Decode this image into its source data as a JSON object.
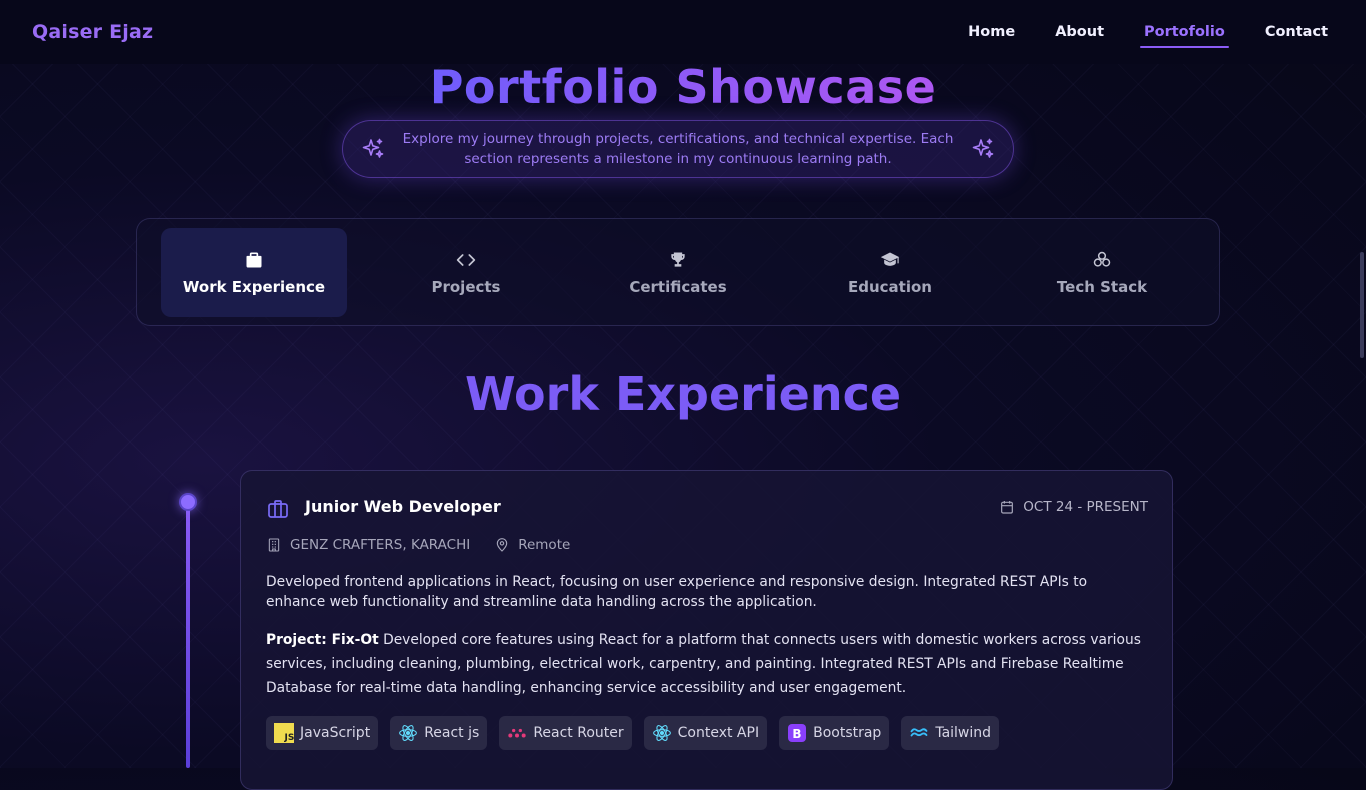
{
  "brand": "Qaiser Ejaz",
  "nav": [
    {
      "label": "Home",
      "active": false
    },
    {
      "label": "About",
      "active": false
    },
    {
      "label": "Portofolio",
      "active": true
    },
    {
      "label": "Contact",
      "active": false
    }
  ],
  "hero": {
    "title": "Portfolio Showcase",
    "subtitle": "Explore my journey through projects, certifications, and technical expertise. Each section represents a milestone in my continuous learning path."
  },
  "tabs": [
    {
      "label": "Work Experience",
      "icon": "briefcase-icon",
      "active": true
    },
    {
      "label": "Projects",
      "icon": "code-icon",
      "active": false
    },
    {
      "label": "Certificates",
      "icon": "trophy-icon",
      "active": false
    },
    {
      "label": "Education",
      "icon": "graduation-cap-icon",
      "active": false
    },
    {
      "label": "Tech Stack",
      "icon": "stack-icon",
      "active": false
    }
  ],
  "section": {
    "title": "Work Experience"
  },
  "job": {
    "title": "Junior Web Developer",
    "date": "OCT 24 - PRESENT",
    "company": "GENZ CRAFTERS, KARACHI",
    "location": "Remote",
    "description": "Developed frontend applications in React, focusing on user experience and responsive design. Integrated REST APIs to enhance web functionality and streamline data handling across the application.",
    "project_label": "Project: Fix-Ot",
    "project_text": " Developed core features using React for a platform that connects users with domestic workers across various services, including cleaning, plumbing, electrical work, carpentry, and painting. Integrated REST APIs and Firebase Realtime Database for real-time data handling, enhancing service accessibility and user engagement.",
    "skills": [
      {
        "label": "JavaScript",
        "icon": "javascript-icon"
      },
      {
        "label": "React js",
        "icon": "react-icon"
      },
      {
        "label": "React Router",
        "icon": "react-router-icon"
      },
      {
        "label": "Context API",
        "icon": "react-icon"
      },
      {
        "label": "Bootstrap",
        "icon": "bootstrap-icon"
      },
      {
        "label": "Tailwind",
        "icon": "tailwind-icon"
      }
    ]
  },
  "colors": {
    "accent": "#8b5cf6",
    "accent2": "#b057f2",
    "bg": "#0b0a24"
  }
}
